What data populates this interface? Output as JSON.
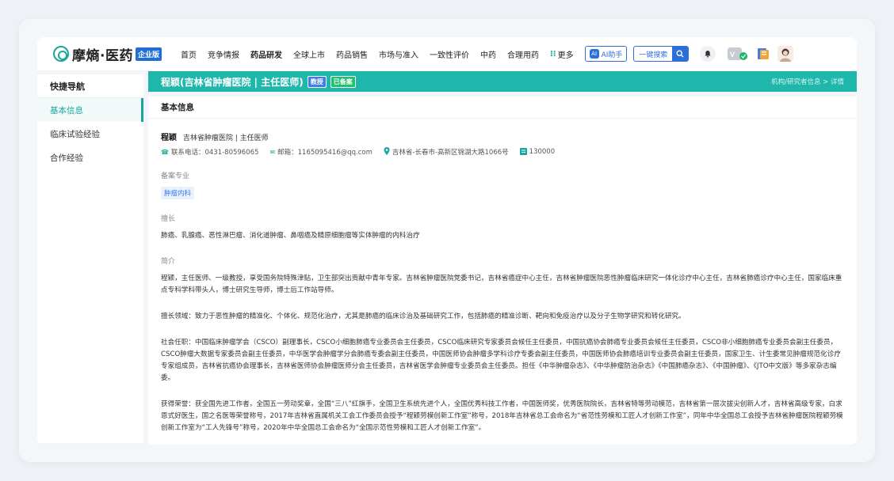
{
  "logo": {
    "text": "摩熵·医药",
    "badge": "企业版"
  },
  "nav": {
    "items": [
      "首页",
      "竞争情报",
      "药品研发",
      "全球上市",
      "药品销售",
      "市场与准入",
      "一致性评价",
      "中药",
      "合理用药"
    ],
    "active": "药品研发",
    "more": "更多",
    "ai_label": "AI助手",
    "search_label": "一键搜索"
  },
  "sidebar": {
    "title": "快捷导航",
    "items": [
      {
        "label": "基本信息",
        "active": true
      },
      {
        "label": "临床试验经验",
        "active": false
      },
      {
        "label": "合作经验",
        "active": false
      }
    ]
  },
  "hero": {
    "name": "程颖(吉林省肿瘤医院 | 主任医师)",
    "tag_title": "教授",
    "tag_status": "已备案",
    "breadcrumb": "机构/研究者信息 > 详情"
  },
  "section": {
    "title": "基本信息"
  },
  "profile": {
    "name": "程颖",
    "affiliation": "吉林省肿瘤医院 | 主任医师",
    "phone": "联系电话：0431-80596065",
    "email": "邮箱：1165095416@qq.com",
    "address": "吉林省-长春市-高新区锦湖大路1066号",
    "postcode": "130000"
  },
  "specialty": {
    "label": "备案专业",
    "tag": "肿瘤内科"
  },
  "expertise": {
    "label": "擅长",
    "text": "肺癌、乳腺癌、恶性淋巴瘤、消化道肿瘤、鼻咽癌及精原细胞瘤等实体肿瘤的内科治疗"
  },
  "intro": {
    "label": "简介",
    "p1": "程颖，主任医师、一级教授，享受国务院特殊津贴，卫生部突出贡献中青年专家。吉林省肿瘤医院党委书记，吉林省癌症中心主任，吉林省肿瘤医院恶性肿瘤临床研究一体化诊疗中心主任，吉林省肺癌诊疗中心主任，国家临床重点专科学科带头人，博士研究生导师，博士后工作站导师。",
    "p2": "擅长领域：致力于恶性肿瘤的精准化、个体化、规范化治疗，尤其是肺癌的临床诊治及基础研究工作，包括肺癌的精准诊断、靶向和免疫治疗以及分子生物学研究和转化研究。",
    "p3": "社会任职：中国临床肿瘤学会（CSCO）副理事长，CSCO小细胞肺癌专业委员会主任委员，CSCO临床研究专家委员会候任主任委员，中国抗癌协会肺癌专业委员会候任主任委员，CSCO非小细胞肺癌专业委员会副主任委员，CSCO肿瘤大数据专家委员会副主任委员，中华医学会肿瘤学分会肺癌专委会副主任委员，中国医师协会肿瘤多学科诊疗专委会副主任委员，中国医师协会肺癌培训专业委员会副主任委员，国家卫生、计生委常见肿瘤规范化诊疗专家组成员，吉林省抗癌协会理事长，吉林省医师协会肿瘤医师分会主任委员，吉林省医学会肿瘤专业委员会主任委员。担任《中华肿瘤杂志》、《中华肿瘤防治杂志》《中国肺癌杂志》、《中国肿瘤》、《JTO中文版》等多家杂志编委。",
    "p4": "获得荣誉：获全国先进工作者，全国五一劳动奖章，全国“三八”红旗手，全国卫生系统先进个人，全国优秀科技工作者，中国医师奖，优秀医院院长，吉林省特等劳动模范，吉林省第一层次拔尖创新人才，吉林省高级专家，白求恩式好医生，国之名医等荣誉称号，2017年吉林省直属机关工会工作委员会授予“程颖劳模创新工作室”称号，2018年吉林省总工会命名为“省范性劳模和工匠人才创新工作室”，同年中华全国总工会授予吉林省肿瘤医院程颖劳模创新工作室为“工人先锋号”称号，2020年中华全国总工会命名为“全国示范性劳模和工匠人才创新工作室”。"
  }
}
